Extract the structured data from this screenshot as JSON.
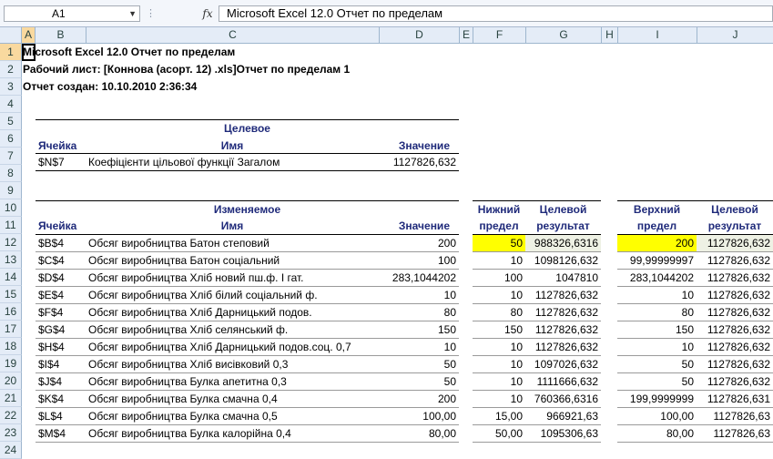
{
  "formula_bar": {
    "cell_ref": "A1",
    "fx_label": "fx",
    "content": "Microsoft Excel 12.0 Отчет по пределам"
  },
  "columns": [
    "A",
    "B",
    "C",
    "D",
    "E",
    "F",
    "G",
    "H",
    "I",
    "J"
  ],
  "rows": [
    "1",
    "2",
    "3",
    "4",
    "5",
    "6",
    "7",
    "8",
    "9",
    "10",
    "11",
    "12",
    "13",
    "14",
    "15",
    "16",
    "17",
    "18",
    "19",
    "20",
    "21",
    "22",
    "23",
    "24"
  ],
  "report": {
    "title": "Microsoft Excel 12.0 Отчет по пределам",
    "sheet": "Рабочий лист: [Коннова (асорт. 12) .xls]Отчет по пределам 1",
    "created": "Отчет создан: 10.10.2010 2:36:34"
  },
  "target": {
    "header_group": "Целевое",
    "col_cell": "Ячейка",
    "col_name": "Имя",
    "col_value": "Значение",
    "row": {
      "cell": "$N$7",
      "name": "Коефіцієнти цільової функції Загалом",
      "value": "1127826,632"
    }
  },
  "variables": {
    "header_group": "Изменяемое",
    "col_cell": "Ячейка",
    "col_name": "Имя",
    "col_value": "Значение",
    "lower_1": "Нижний",
    "lower_2": "предел",
    "target_1": "Целевой",
    "target_2": "результат",
    "upper_1": "Верхний",
    "upper_2": "предел",
    "target2_1": "Целевой",
    "target2_2": "результат",
    "rows": [
      {
        "cell": "$B$4",
        "name": "Обсяг виробництва  Батон степовий",
        "value": "200",
        "lower": "50",
        "lower_result": "988326,6316",
        "upper": "200",
        "upper_result": "1127826,632"
      },
      {
        "cell": "$C$4",
        "name": "Обсяг виробництва Батон соціальний",
        "value": "100",
        "lower": "10",
        "lower_result": "1098126,632",
        "upper": "99,99999997",
        "upper_result": "1127826,632"
      },
      {
        "cell": "$D$4",
        "name": "Обсяг виробництва Хліб новий пш.ф. І гат.",
        "value": "283,1044202",
        "lower": "100",
        "lower_result": "1047810",
        "upper": "283,1044202",
        "upper_result": "1127826,632"
      },
      {
        "cell": "$E$4",
        "name": "Обсяг виробництва Хліб білий соціальний ф.",
        "value": "10",
        "lower": "10",
        "lower_result": "1127826,632",
        "upper": "10",
        "upper_result": "1127826,632"
      },
      {
        "cell": "$F$4",
        "name": "Обсяг виробництва Хліб Дарницький подов.",
        "value": "80",
        "lower": "80",
        "lower_result": "1127826,632",
        "upper": "80",
        "upper_result": "1127826,632"
      },
      {
        "cell": "$G$4",
        "name": "Обсяг виробництва Хліб селянський ф.",
        "value": "150",
        "lower": "150",
        "lower_result": "1127826,632",
        "upper": "150",
        "upper_result": "1127826,632"
      },
      {
        "cell": "$H$4",
        "name": "Обсяг виробництва Хліб Дарницький подов.соц. 0,7",
        "value": "10",
        "lower": "10",
        "lower_result": "1127826,632",
        "upper": "10",
        "upper_result": "1127826,632"
      },
      {
        "cell": "$I$4",
        "name": "Обсяг виробництва Хліб висівковий 0,3",
        "value": "50",
        "lower": "10",
        "lower_result": "1097026,632",
        "upper": "50",
        "upper_result": "1127826,632"
      },
      {
        "cell": "$J$4",
        "name": "Обсяг виробництва Булка апетитна 0,3",
        "value": "50",
        "lower": "10",
        "lower_result": "1111666,632",
        "upper": "50",
        "upper_result": "1127826,632"
      },
      {
        "cell": "$K$4",
        "name": "Обсяг виробництва Булка смачна 0,4",
        "value": "200",
        "lower": "10",
        "lower_result": "760366,6316",
        "upper": "199,9999999",
        "upper_result": "1127826,631"
      },
      {
        "cell": "$L$4",
        "name": "Обсяг виробництва Булка смачна 0,5",
        "value": "100,00",
        "lower": "15,00",
        "lower_result": "966921,63",
        "upper": "100,00",
        "upper_result": "1127826,63"
      },
      {
        "cell": "$M$4",
        "name": "Обсяг виробництва Булка калорійна 0,4",
        "value": "80,00",
        "lower": "50,00",
        "lower_result": "1095306,63",
        "upper": "80,00",
        "upper_result": "1127826,63"
      }
    ]
  }
}
